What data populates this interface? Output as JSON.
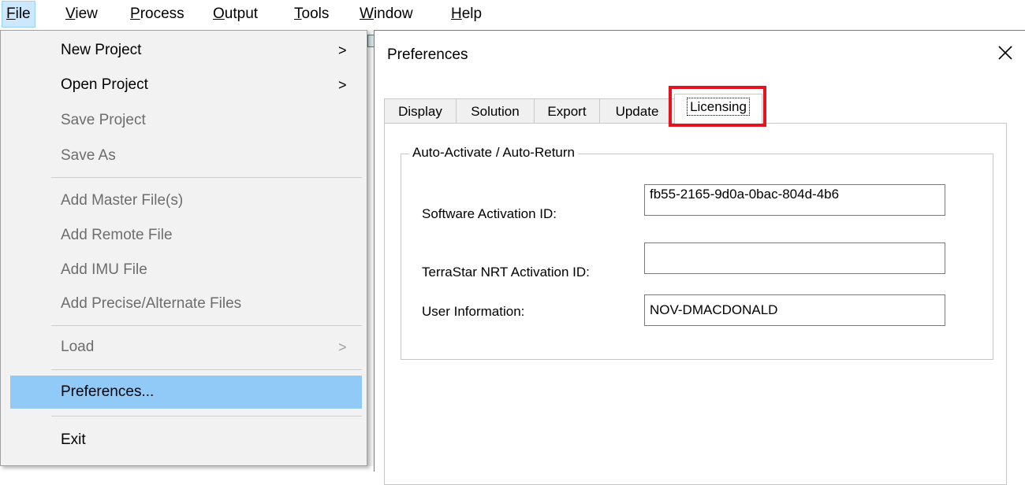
{
  "menubar": {
    "items": [
      {
        "label": "File",
        "accel": "F"
      },
      {
        "label": "View",
        "accel": "V"
      },
      {
        "label": "Process",
        "accel": "P"
      },
      {
        "label": "Output",
        "accel": "O"
      },
      {
        "label": "Tools",
        "accel": "T"
      },
      {
        "label": "Window",
        "accel": "W"
      },
      {
        "label": "Help",
        "accel": "H"
      }
    ]
  },
  "file_menu": {
    "items": [
      {
        "label": "New Project",
        "submenu": true,
        "enabled": true
      },
      {
        "label": "Open Project",
        "submenu": true,
        "enabled": true
      },
      {
        "label": "Save Project",
        "enabled": false
      },
      {
        "label": "Save As",
        "enabled": false
      },
      {
        "label": "Add Master File(s)",
        "enabled": false
      },
      {
        "label": "Add Remote File",
        "enabled": false
      },
      {
        "label": "Add IMU File",
        "enabled": false
      },
      {
        "label": "Add Precise/Alternate Files",
        "enabled": false
      },
      {
        "label": "Load",
        "submenu": true,
        "enabled": false
      },
      {
        "label": "Preferences...",
        "enabled": true,
        "highlighted": true
      },
      {
        "label": "Exit",
        "enabled": true
      }
    ],
    "submenu_arrow": ">"
  },
  "dialog": {
    "title": "Preferences",
    "close_glyph": "✕",
    "tabs": [
      "Display",
      "Solution",
      "Export",
      "Update",
      "Licensing"
    ],
    "selected_tab": "Licensing",
    "group_title": "Auto-Activate / Auto-Return",
    "fields": {
      "software_activation": {
        "label": "Software Activation ID:",
        "value": "fb55-2165-9d0a-0bac-804d-4b6"
      },
      "terrastar_activation": {
        "label": "TerraStar NRT Activation ID:",
        "value": ""
      },
      "user_information": {
        "label": "User Information:",
        "value": "NOV-DMACDONALD"
      }
    }
  },
  "colors": {
    "menu_highlight": "#91c9f7",
    "menubar_active": "#cce8ff",
    "annotation_red": "#e3141d",
    "disabled_text": "#6d6d6d"
  }
}
